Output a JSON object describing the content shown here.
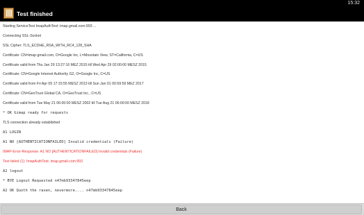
{
  "status_bar": {
    "time": "15:32"
  },
  "action_bar": {
    "title": "Test finished",
    "app_icon": "mail-test-app-icon"
  },
  "log": {
    "lines": [
      {
        "text": "Starting ServiceTest ImapAuthTest: imap.gmail.com:993 ..."
      },
      {
        "text": "Connecting SSL-Socket"
      },
      {
        "text": "SSL Cipher: TLS_ECDHE_RSA_WITH_RC4_128_SHA"
      },
      {
        "text": "Certificate: CN=imap.gmail.com, O=Google Inc, L=Mountain View, ST=California, C=US"
      },
      {
        "text": "Certificate valid from Thu Jan 29 13:27:16 MEZ 2015 till Wed Apr 29 02:00:00 MESZ 2015"
      },
      {
        "text": "Certificate: CN=Google Internet Authority G2, O=Google Inc, C=US"
      },
      {
        "text": "Certificate valid from Fri Apr 05 17:15:55 MESZ 2013 till Sun Jan 01 00:59:59 MEZ 2017"
      },
      {
        "text": "Certificate: CN=GeoTrust Global CA, O=GeoTrust Inc., C=US"
      },
      {
        "text": "Certificate valid from Tue May 21 06:00:00 MESZ 2002 till Tue Aug 21 06:00:00 MESZ 2018"
      },
      {
        "text": "* OK Gimap ready for requests"
      },
      {
        "text": "TLS connection already established"
      },
      {
        "text": "A1 LOGIN"
      },
      {
        "text": "A1 NO [AUTHENTICATIONFAILED] Invalid credentials (Failure)"
      },
      {
        "text": "IMAP-Error-Response: A1 NO [AUTHENTICATIONFAILED] Invalid credentials (Failure)"
      },
      {
        "text": "Test failed (1): ImapAuthTest: imap.gmail.com:993"
      },
      {
        "text": "A2 logout"
      },
      {
        "text": "* BYE Logout Requested n47mb93347845eep"
      },
      {
        "text": "A2 OK Quoth the raven, nevermore.... n47mb93347845eep"
      }
    ],
    "error_color": "#ee3333",
    "text_color": "#333333"
  },
  "bottom_bar": {
    "back_label": "Back"
  }
}
